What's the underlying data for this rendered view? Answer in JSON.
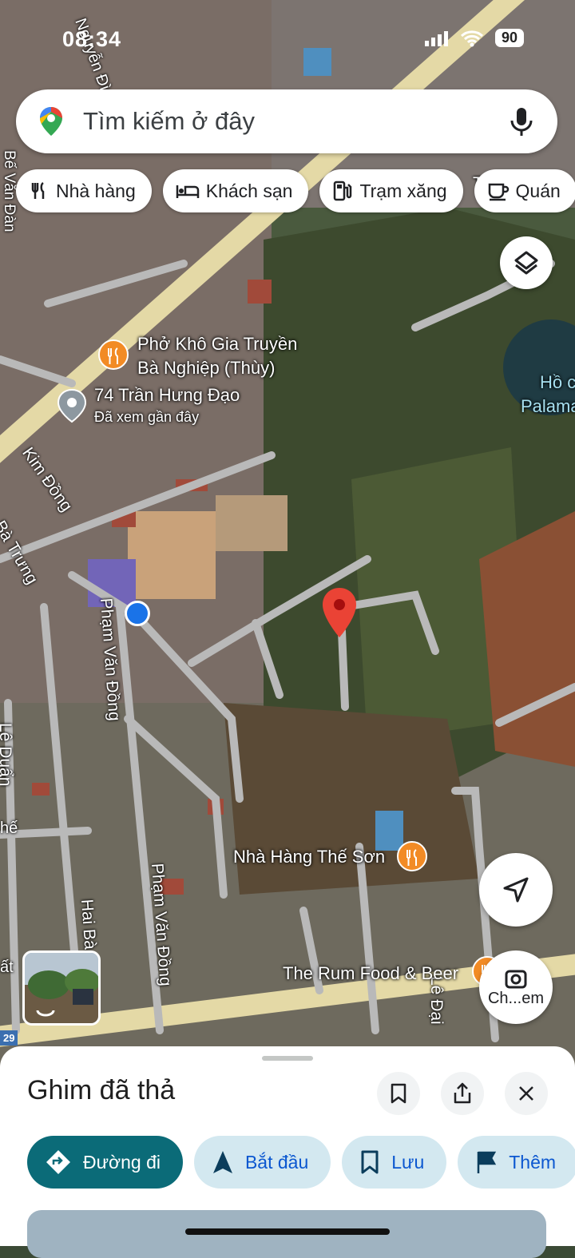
{
  "status_bar": {
    "time": "08:34",
    "battery": "90"
  },
  "search": {
    "placeholder": "Tìm kiếm ở đây"
  },
  "chips": [
    {
      "label": "Nhà hàng",
      "icon": "fork-knife-icon"
    },
    {
      "label": "Khách sạn",
      "icon": "bed-icon"
    },
    {
      "label": "Trạm xăng",
      "icon": "gas-pump-icon"
    },
    {
      "label": "Quán",
      "icon": "coffee-cup-icon"
    }
  ],
  "map": {
    "streets": [
      "Nguyễn Đình Chiểu",
      "Kim Đồng",
      "Phạm Văn Đồng",
      "Phạm Văn Đồng",
      "Hai Bà",
      "Lê Đại",
      "Lê Duẩn",
      "Bà Trưng",
      "Bế Văn Đàn",
      "Th"
    ],
    "places": [
      {
        "line1": "Phở Khô Gia Truyền",
        "line2": "Bà Nghiệp (Thùy)",
        "type": "restaurant"
      },
      {
        "line1": "74 Trần Hưng Đạo",
        "line2": "Đã xem gần đây",
        "type": "recent"
      },
      {
        "line1": "Hồ c",
        "line2": "Palama",
        "type": "lake"
      },
      {
        "line1": "Nhà Hàng Thế Sơn",
        "line2": "",
        "type": "restaurant"
      },
      {
        "line1": "The Rum Food & Beer",
        "line2": "",
        "type": "restaurant"
      }
    ],
    "road_number": "29",
    "edge_labels": [
      "hế",
      "ất"
    ],
    "lens_label": "Ch...em"
  },
  "sheet": {
    "title": "Ghim đã thả",
    "actions": [
      {
        "label": "Đường đi",
        "icon": "directions-icon"
      },
      {
        "label": "Bắt đầu",
        "icon": "navigation-arrow-icon"
      },
      {
        "label": "Lưu",
        "icon": "bookmark-icon"
      },
      {
        "label": "Thêm",
        "icon": "flag-icon"
      }
    ]
  },
  "colors": {
    "accent": "#0b6b78",
    "pin": "#ea4335",
    "location": "#1a73e8",
    "restaurant": "#f28b25"
  }
}
